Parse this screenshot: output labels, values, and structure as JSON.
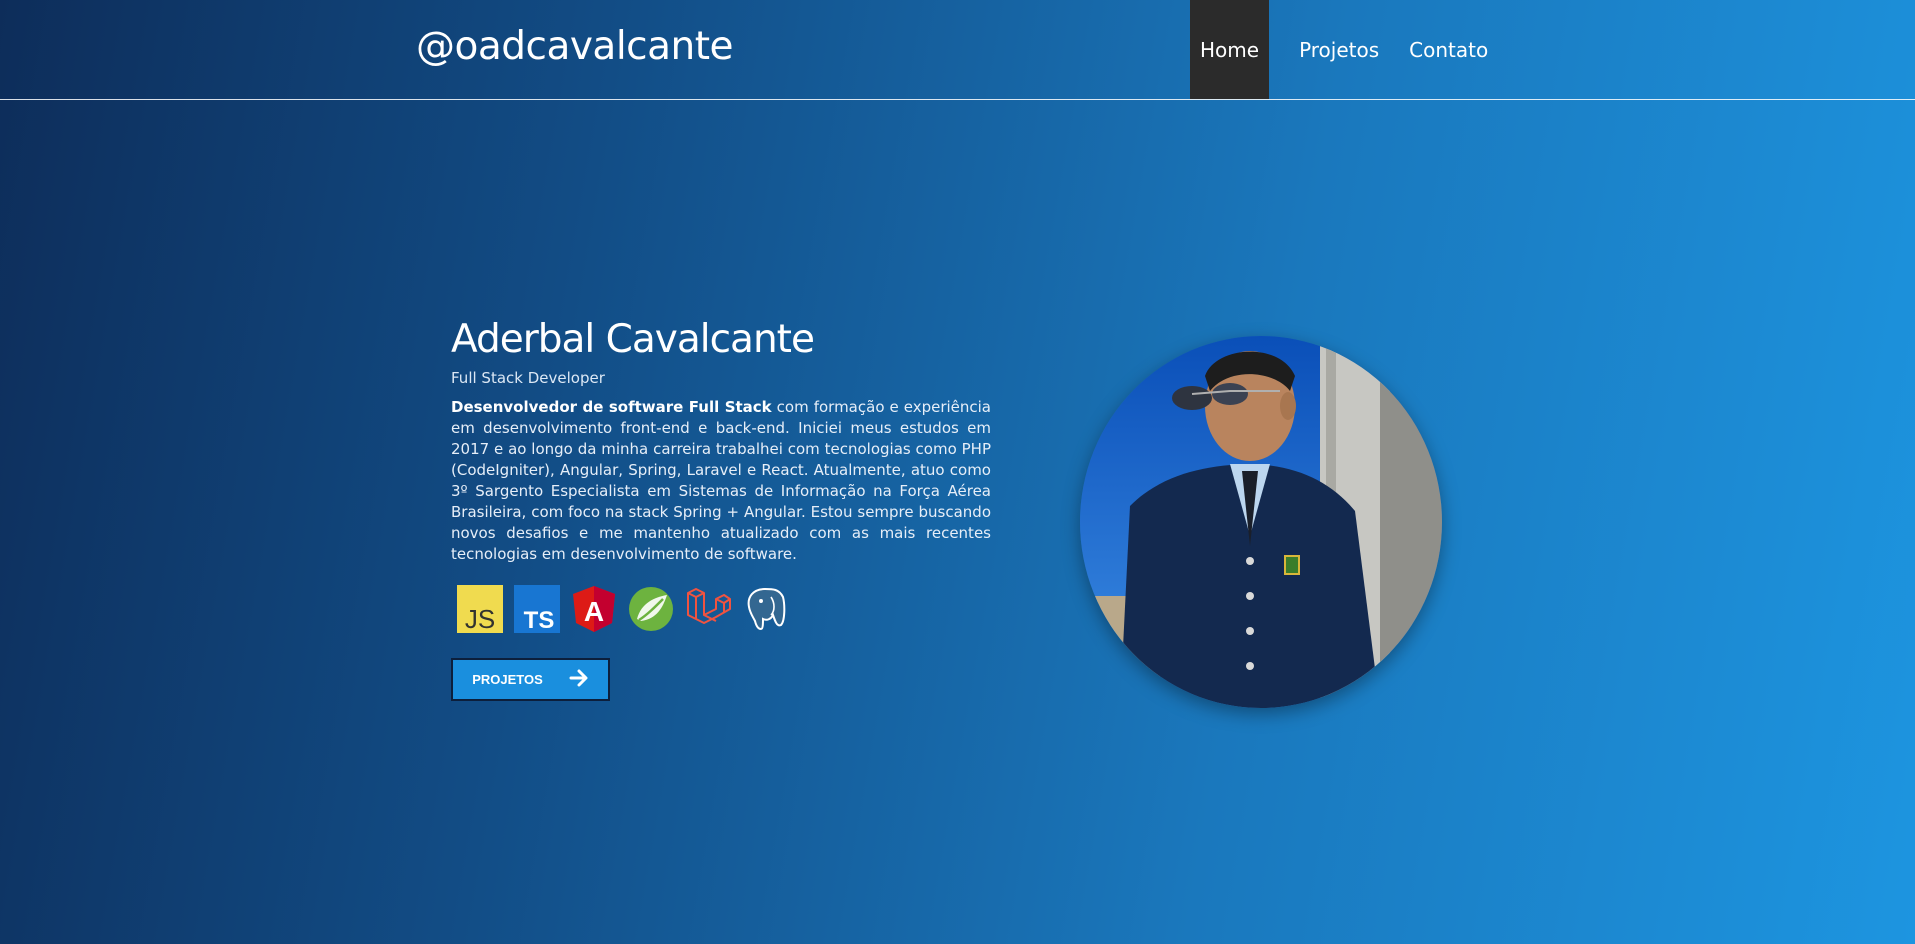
{
  "header": {
    "logo": "@oadcavalcante",
    "nav": [
      {
        "label": "Home",
        "active": true
      },
      {
        "label": "Projetos",
        "active": false
      },
      {
        "label": "Contato",
        "active": false
      }
    ]
  },
  "hero": {
    "name": "Aderbal Cavalcante",
    "role": "Full Stack Developer",
    "description_bold": "Desenvolvedor de software Full Stack",
    "description_rest": " com formação e experiência em desenvolvimento front-end e back-end. Iniciei meus estudos em 2017 e ao longo da minha carreira trabalhei com tecnologias como PHP (CodeIgniter), Angular, Spring, Laravel e React. Atualmente, atuo como 3º Sargento Especialista em Sistemas de Informação na Força Aérea Brasileira, com foco na stack Spring + Angular. Estou sempre buscando novos desafios e me mantenho atualizado com as mais recentes tecnologias em desenvolvimento de software.",
    "tech_icons": [
      {
        "name": "javascript-icon",
        "text": "JS",
        "color": "#f0db4f"
      },
      {
        "name": "typescript-icon",
        "text": "TS",
        "color": "#1876d2"
      },
      {
        "name": "angular-icon",
        "text": "A",
        "color": "#dd1b16"
      },
      {
        "name": "spring-icon",
        "color": "#6db33f"
      },
      {
        "name": "laravel-icon",
        "color": "#f05340"
      },
      {
        "name": "postgresql-icon",
        "color": "#ffffff"
      }
    ],
    "button_label": "PROJETOS"
  },
  "colors": {
    "accent_button": "#1a8fde",
    "nav_active_bg": "#2b2b2b",
    "gradient_start": "#0d2d5a",
    "gradient_end": "#1d95e0"
  }
}
